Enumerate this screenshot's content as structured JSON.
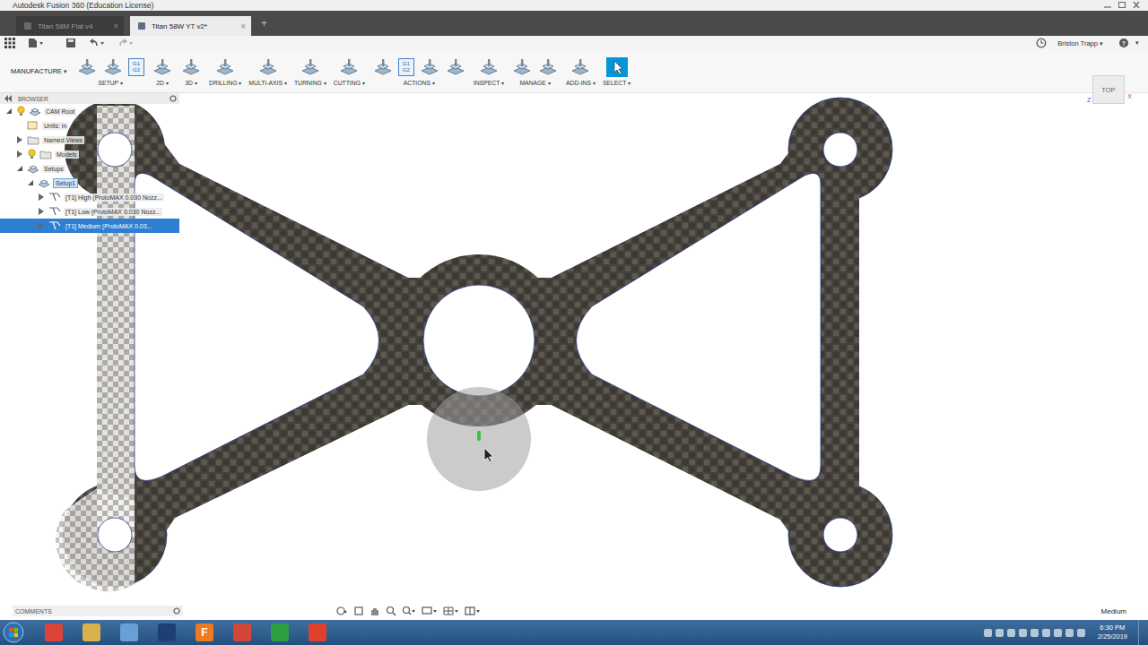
{
  "window": {
    "title": "Autodesk Fusion 360 (Education License)"
  },
  "tabs": [
    {
      "label": "Titan 58M Flat v4",
      "selected": false
    },
    {
      "label": "Titan 58W YT v2*",
      "selected": true
    }
  ],
  "tab_close": "×",
  "tab_add": "+",
  "quick_access": {
    "user": "Briston Trapp",
    "caret": "▾",
    "help": "?"
  },
  "toolbar": {
    "workspace": "MANUFACTURE",
    "caret": "▾",
    "groups": [
      {
        "label": "SETUP",
        "selected": false,
        "buttons": [
          {
            "kind": "icon"
          },
          {
            "kind": "icon"
          },
          {
            "kind": "code",
            "text": "G1 G2"
          }
        ]
      },
      {
        "label": "2D",
        "selected": false,
        "buttons": [
          {
            "kind": "icon"
          }
        ]
      },
      {
        "label": "3D",
        "selected": false,
        "buttons": [
          {
            "kind": "icon"
          }
        ]
      },
      {
        "label": "DRILLING",
        "selected": false,
        "buttons": [
          {
            "kind": "icon"
          }
        ]
      },
      {
        "label": "MULTI-AXIS",
        "selected": false,
        "buttons": [
          {
            "kind": "icon"
          }
        ]
      },
      {
        "label": "TURNING",
        "selected": false,
        "buttons": [
          {
            "kind": "icon"
          }
        ]
      },
      {
        "label": "CUTTING",
        "selected": false,
        "buttons": [
          {
            "kind": "icon"
          }
        ]
      },
      {
        "label": "ACTIONS",
        "selected": false,
        "buttons": [
          {
            "kind": "icon"
          },
          {
            "kind": "code",
            "text": "G1 G2"
          },
          {
            "kind": "icon"
          },
          {
            "kind": "icon"
          }
        ]
      },
      {
        "label": "INSPECT",
        "selected": false,
        "buttons": [
          {
            "kind": "icon"
          }
        ]
      },
      {
        "label": "MANAGE",
        "selected": false,
        "buttons": [
          {
            "kind": "icon"
          },
          {
            "kind": "icon"
          }
        ]
      },
      {
        "label": "ADD-INS",
        "selected": false,
        "buttons": [
          {
            "kind": "icon"
          }
        ]
      },
      {
        "label": "SELECT",
        "selected": true,
        "buttons": [
          {
            "kind": "icon"
          }
        ]
      }
    ]
  },
  "browser": {
    "title": "BROWSER",
    "items": [
      {
        "label": "CAM Root",
        "level": 0,
        "kind": "root",
        "expandable": true,
        "expanded": true,
        "light_bulb": true,
        "selected": false,
        "active": false
      },
      {
        "label": "Units: in",
        "level": 1,
        "kind": "units",
        "expandable": false,
        "expanded": false,
        "light_bulb": false,
        "selected": false,
        "active": false
      },
      {
        "label": "Named Views",
        "level": 1,
        "kind": "views",
        "expandable": true,
        "expanded": false,
        "light_bulb": false,
        "selected": false,
        "active": false
      },
      {
        "label": "Models",
        "level": 1,
        "kind": "models",
        "expandable": true,
        "expanded": false,
        "light_bulb": true,
        "selected": false,
        "active": false
      },
      {
        "label": "Setups",
        "level": 1,
        "kind": "setups",
        "expandable": true,
        "expanded": true,
        "light_bulb": false,
        "selected": false,
        "active": false
      },
      {
        "label": "Setup1",
        "level": 2,
        "kind": "setup",
        "expandable": true,
        "expanded": true,
        "light_bulb": false,
        "selected": false,
        "active": true
      },
      {
        "label": "[T1] High (ProtoMAX 0.030 Nozz...",
        "level": 3,
        "kind": "operation",
        "expandable": true,
        "expanded": false,
        "light_bulb": false,
        "selected": false,
        "active": false
      },
      {
        "label": "[T1] Low (ProtoMAX 0.030 Nozz...",
        "level": 3,
        "kind": "operation",
        "expandable": true,
        "expanded": false,
        "light_bulb": false,
        "selected": false,
        "active": false
      },
      {
        "label": "[T1] Medium (ProtoMAX 0.03...",
        "level": 3,
        "kind": "operation",
        "expandable": true,
        "expanded": false,
        "light_bulb": false,
        "selected": true,
        "active": false
      }
    ]
  },
  "viewcube": {
    "label": "TOP",
    "axes": [
      "Z",
      "X"
    ]
  },
  "comments": {
    "title": "COMMENTS"
  },
  "status": {
    "text": "Medium"
  },
  "taskbar": {
    "time": "6:30 PM",
    "date": "2/25/2019",
    "apps": [
      {
        "color": "#db4437"
      },
      {
        "color": "#d9b24a"
      },
      {
        "color": "#6a9fd4"
      },
      {
        "color": "#1d3f72"
      },
      {
        "color": "#f07a1e",
        "glyph": "F"
      },
      {
        "color": "#d44638"
      },
      {
        "color": "#2ea043"
      },
      {
        "color": "#e2402b"
      }
    ]
  }
}
